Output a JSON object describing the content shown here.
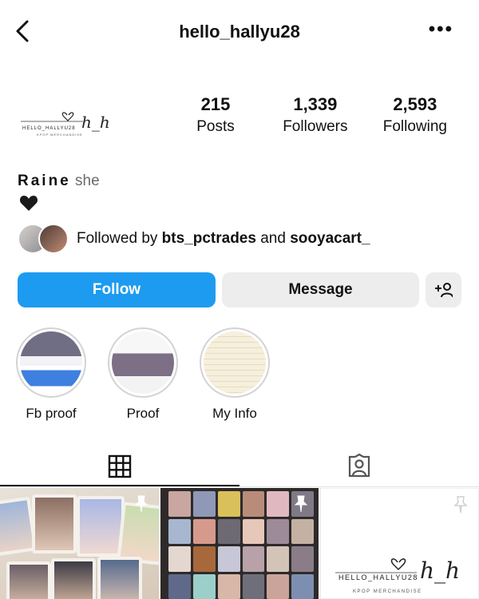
{
  "header": {
    "username": "hello_hallyu28",
    "back_icon": "chevron-left-icon",
    "more_icon": "more-horizontal-icon"
  },
  "profile": {
    "logo_text": "HELLO_HALLYU28",
    "logo_monogram": "h_h",
    "logo_subtext": "KPOP MERCHANDISE",
    "stats": [
      {
        "num": "215",
        "label": "Posts"
      },
      {
        "num": "1,339",
        "label": "Followers"
      },
      {
        "num": "2,593",
        "label": "Following"
      }
    ],
    "name": "Raine",
    "pronouns": "she",
    "bio_emoji": "black-heart-icon"
  },
  "followed_by": {
    "prefix": "Followed by",
    "user1": "bts_pctrades",
    "connector": "and",
    "user2": "sooyacart_"
  },
  "actions": {
    "follow_label": "Follow",
    "message_label": "Message",
    "add_icon": "add-person-icon",
    "follow_color": "#1d9bf0"
  },
  "highlights": [
    {
      "label": "Fb proof"
    },
    {
      "label": "Proof"
    },
    {
      "label": "My Info"
    }
  ],
  "tabs": {
    "grid_icon": "grid-icon",
    "tagged_icon": "tagged-person-icon",
    "active": "grid"
  },
  "posts": {
    "pin_icon": "pin-icon",
    "post3_logo_text": "HELLO_HALLYU28",
    "post3_logo_monogram": "h_h",
    "post3_logo_subtext": "KPOP MERCHANDISE"
  }
}
